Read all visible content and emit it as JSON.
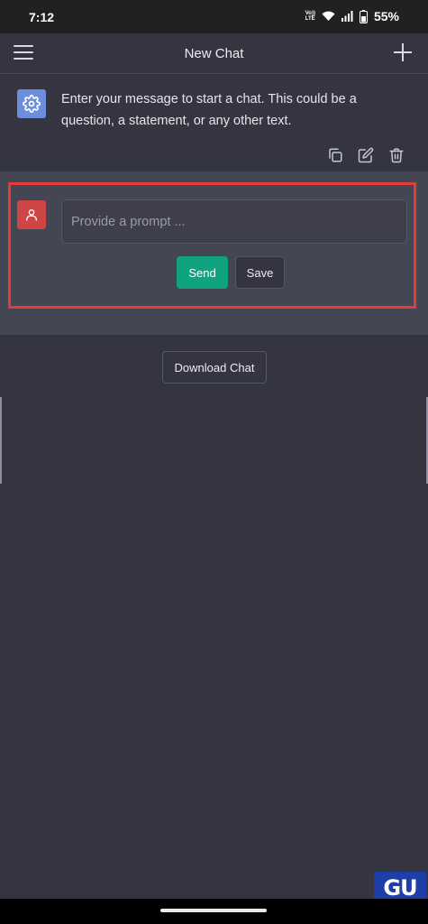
{
  "status_bar": {
    "time": "7:12",
    "volte_top": "Vo))",
    "volte_bottom": "LTE",
    "battery": "55%"
  },
  "header": {
    "title": "New Chat"
  },
  "system_message": {
    "text": "Enter your message to start a chat. This could be a question, a statement, or any other text."
  },
  "prompt": {
    "placeholder": "Provide a prompt ...",
    "value": ""
  },
  "buttons": {
    "send": "Send",
    "save": "Save",
    "download": "Download Chat"
  },
  "watermark": {
    "text": "GU"
  },
  "colors": {
    "background": "#343541",
    "prompt_section": "#444654",
    "accent_send": "#10a37f",
    "system_avatar": "#6b8fdc",
    "user_avatar": "#cf4545",
    "highlight_border": "#e53b32"
  }
}
